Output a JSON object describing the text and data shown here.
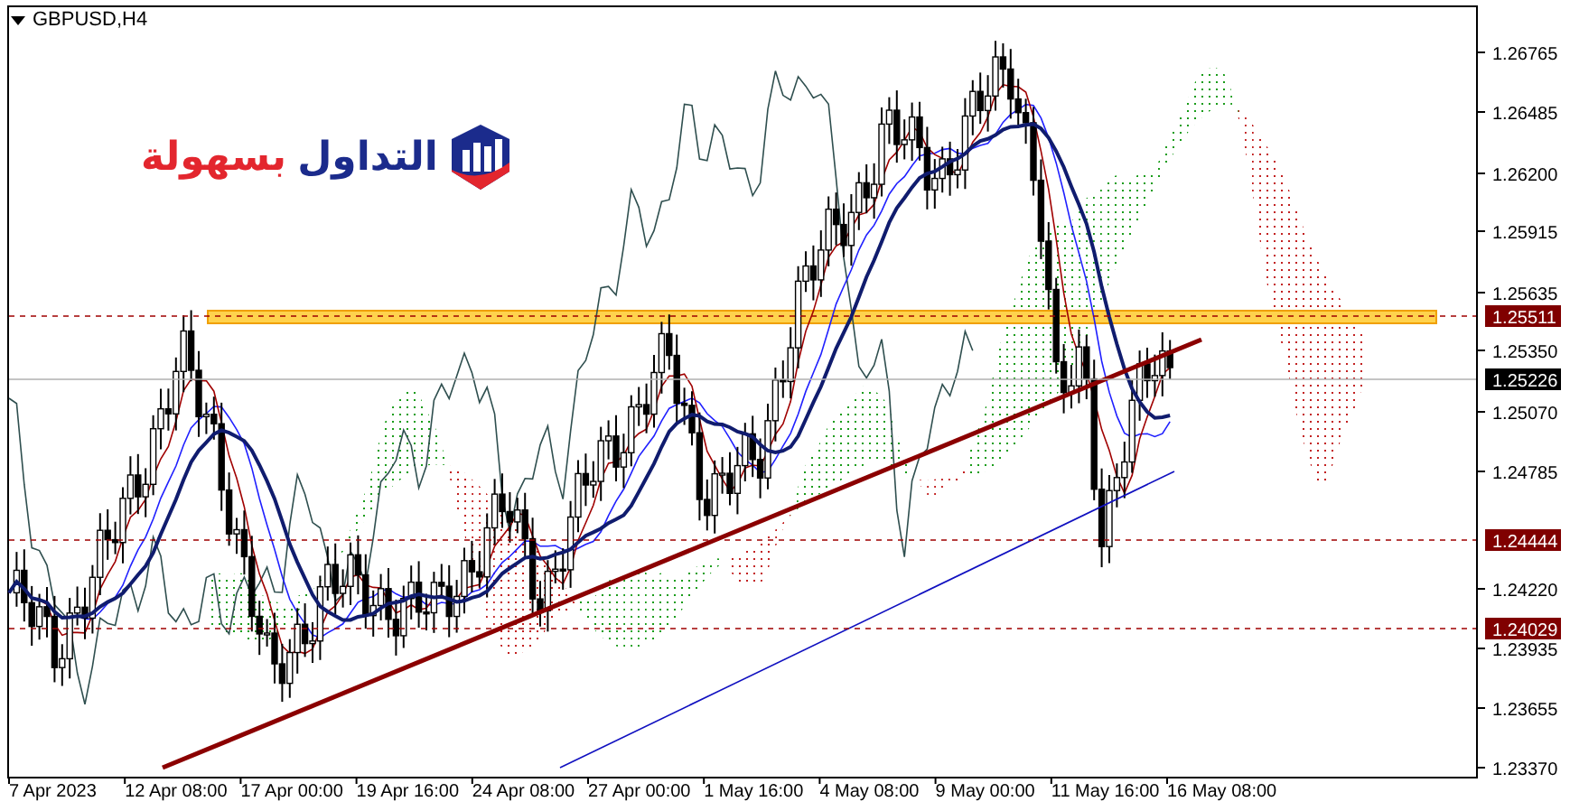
{
  "chart": {
    "title": "GBPUSD,H4",
    "logo": {
      "text_primary": "التداول",
      "text_accent": "بسهولة"
    },
    "price_axis": [
      "1.26765",
      "1.26485",
      "1.26200",
      "1.25915",
      "1.25635",
      "1.25350",
      "1.25070",
      "1.24785",
      "1.24220",
      "1.23935",
      "1.23655",
      "1.23370"
    ],
    "price_tags": [
      {
        "text": "1.25511",
        "kind": "level"
      },
      {
        "text": "1.25226",
        "kind": "current"
      },
      {
        "text": "1.24444",
        "kind": "level"
      },
      {
        "text": "1.24029",
        "kind": "level"
      }
    ],
    "time_axis": [
      "7 Apr 2023",
      "12 Apr 08:00",
      "17 Apr 00:00",
      "19 Apr 16:00",
      "24 Apr 08:00",
      "27 Apr 00:00",
      "1 May 16:00",
      "4 May 08:00",
      "9 May 00:00",
      "11 May 16:00",
      "16 May 08:00"
    ]
  }
}
